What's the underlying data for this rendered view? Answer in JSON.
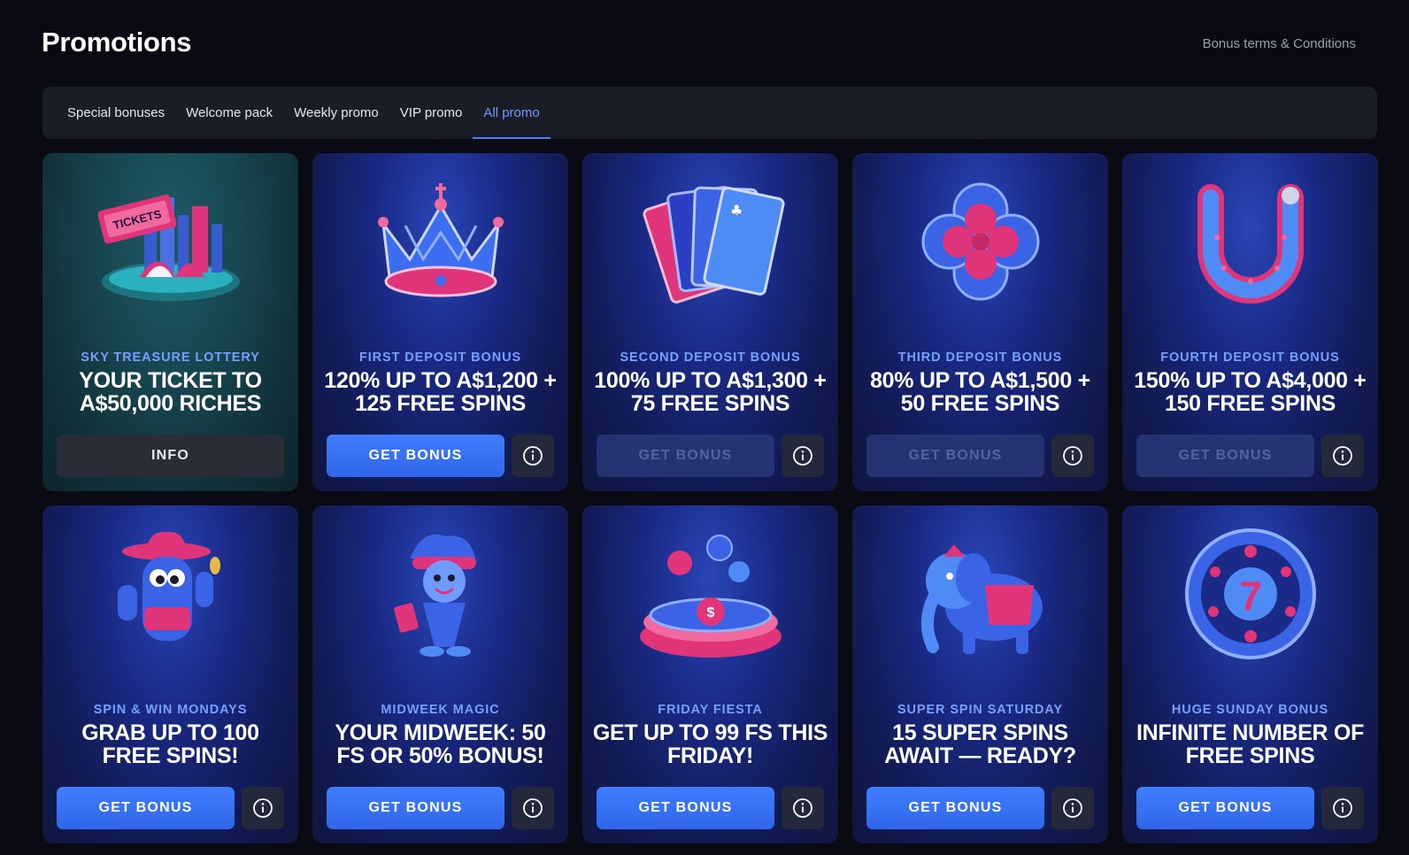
{
  "header": {
    "title": "Promotions",
    "terms_link": "Bonus terms & Conditions"
  },
  "tabs": [
    {
      "label": "Special bonuses",
      "active": false
    },
    {
      "label": "Welcome pack",
      "active": false
    },
    {
      "label": "Weekly promo",
      "active": false
    },
    {
      "label": "VIP promo",
      "active": false
    },
    {
      "label": "All promo",
      "active": true
    }
  ],
  "cards": [
    {
      "eyebrow": "SKY TREASURE LOTTERY",
      "headline": "YOUR TICKET TO A$50,000 RICHES",
      "button": "INFO",
      "button_state": "info",
      "has_info_icon": false,
      "art": "lottery-tickets-city-icon",
      "theme": "teal"
    },
    {
      "eyebrow": "FIRST DEPOSIT BONUS",
      "headline": "120% UP TO A$1,200 + 125 FREE SPINS",
      "button": "GET BONUS",
      "button_state": "active",
      "has_info_icon": true,
      "art": "crown-icon",
      "theme": "blue"
    },
    {
      "eyebrow": "SECOND DEPOSIT BONUS",
      "headline": "100% UP TO A$1,300 + 75 FREE SPINS",
      "button": "GET BONUS",
      "button_state": "disabled",
      "has_info_icon": true,
      "art": "playing-cards-icon",
      "theme": "blue"
    },
    {
      "eyebrow": "THIRD DEPOSIT BONUS",
      "headline": "80% UP TO A$1,500 + 50 FREE SPINS",
      "button": "GET BONUS",
      "button_state": "disabled",
      "has_info_icon": true,
      "art": "four-leaf-clover-icon",
      "theme": "blue"
    },
    {
      "eyebrow": "FOURTH DEPOSIT BONUS",
      "headline": "150% UP TO A$4,000 + 150 FREE SPINS",
      "button": "GET BONUS",
      "button_state": "disabled",
      "has_info_icon": true,
      "art": "horseshoe-icon",
      "theme": "blue"
    },
    {
      "eyebrow": "SPIN & WIN MONDAYS",
      "headline": "GRAB UP TO 100 FREE SPINS!",
      "button": "GET BONUS",
      "button_state": "active",
      "has_info_icon": true,
      "art": "cowboy-cactus-icon",
      "theme": "blue"
    },
    {
      "eyebrow": "MIDWEEK MAGIC",
      "headline": "YOUR MIDWEEK: 50 FS OR 50% BONUS!",
      "button": "GET BONUS",
      "button_state": "active",
      "has_info_icon": true,
      "art": "jester-icon",
      "theme": "blue"
    },
    {
      "eyebrow": "FRIDAY FIESTA",
      "headline": "GET UP TO 99 FS THIS FRIDAY!",
      "button": "GET BONUS",
      "button_state": "active",
      "has_info_icon": true,
      "art": "coins-platform-icon",
      "theme": "blue"
    },
    {
      "eyebrow": "SUPER SPIN SATURDAY",
      "headline": "15 SUPER SPINS AWAIT — READY?",
      "button": "GET BONUS",
      "button_state": "active",
      "has_info_icon": true,
      "art": "elephant-icon",
      "theme": "blue"
    },
    {
      "eyebrow": "HUGE SUNDAY BONUS",
      "headline": "INFINITE NUMBER OF FREE SPINS",
      "button": "GET BONUS",
      "button_state": "active",
      "has_info_icon": true,
      "art": "lucky-seven-wheel-icon",
      "theme": "blue"
    }
  ],
  "colors": {
    "background": "#0a0b12",
    "tab_bar": "#1b1d26",
    "accent": "#4d7ef7",
    "eyebrow": "#76a0ff",
    "pink": "#e0357a"
  }
}
